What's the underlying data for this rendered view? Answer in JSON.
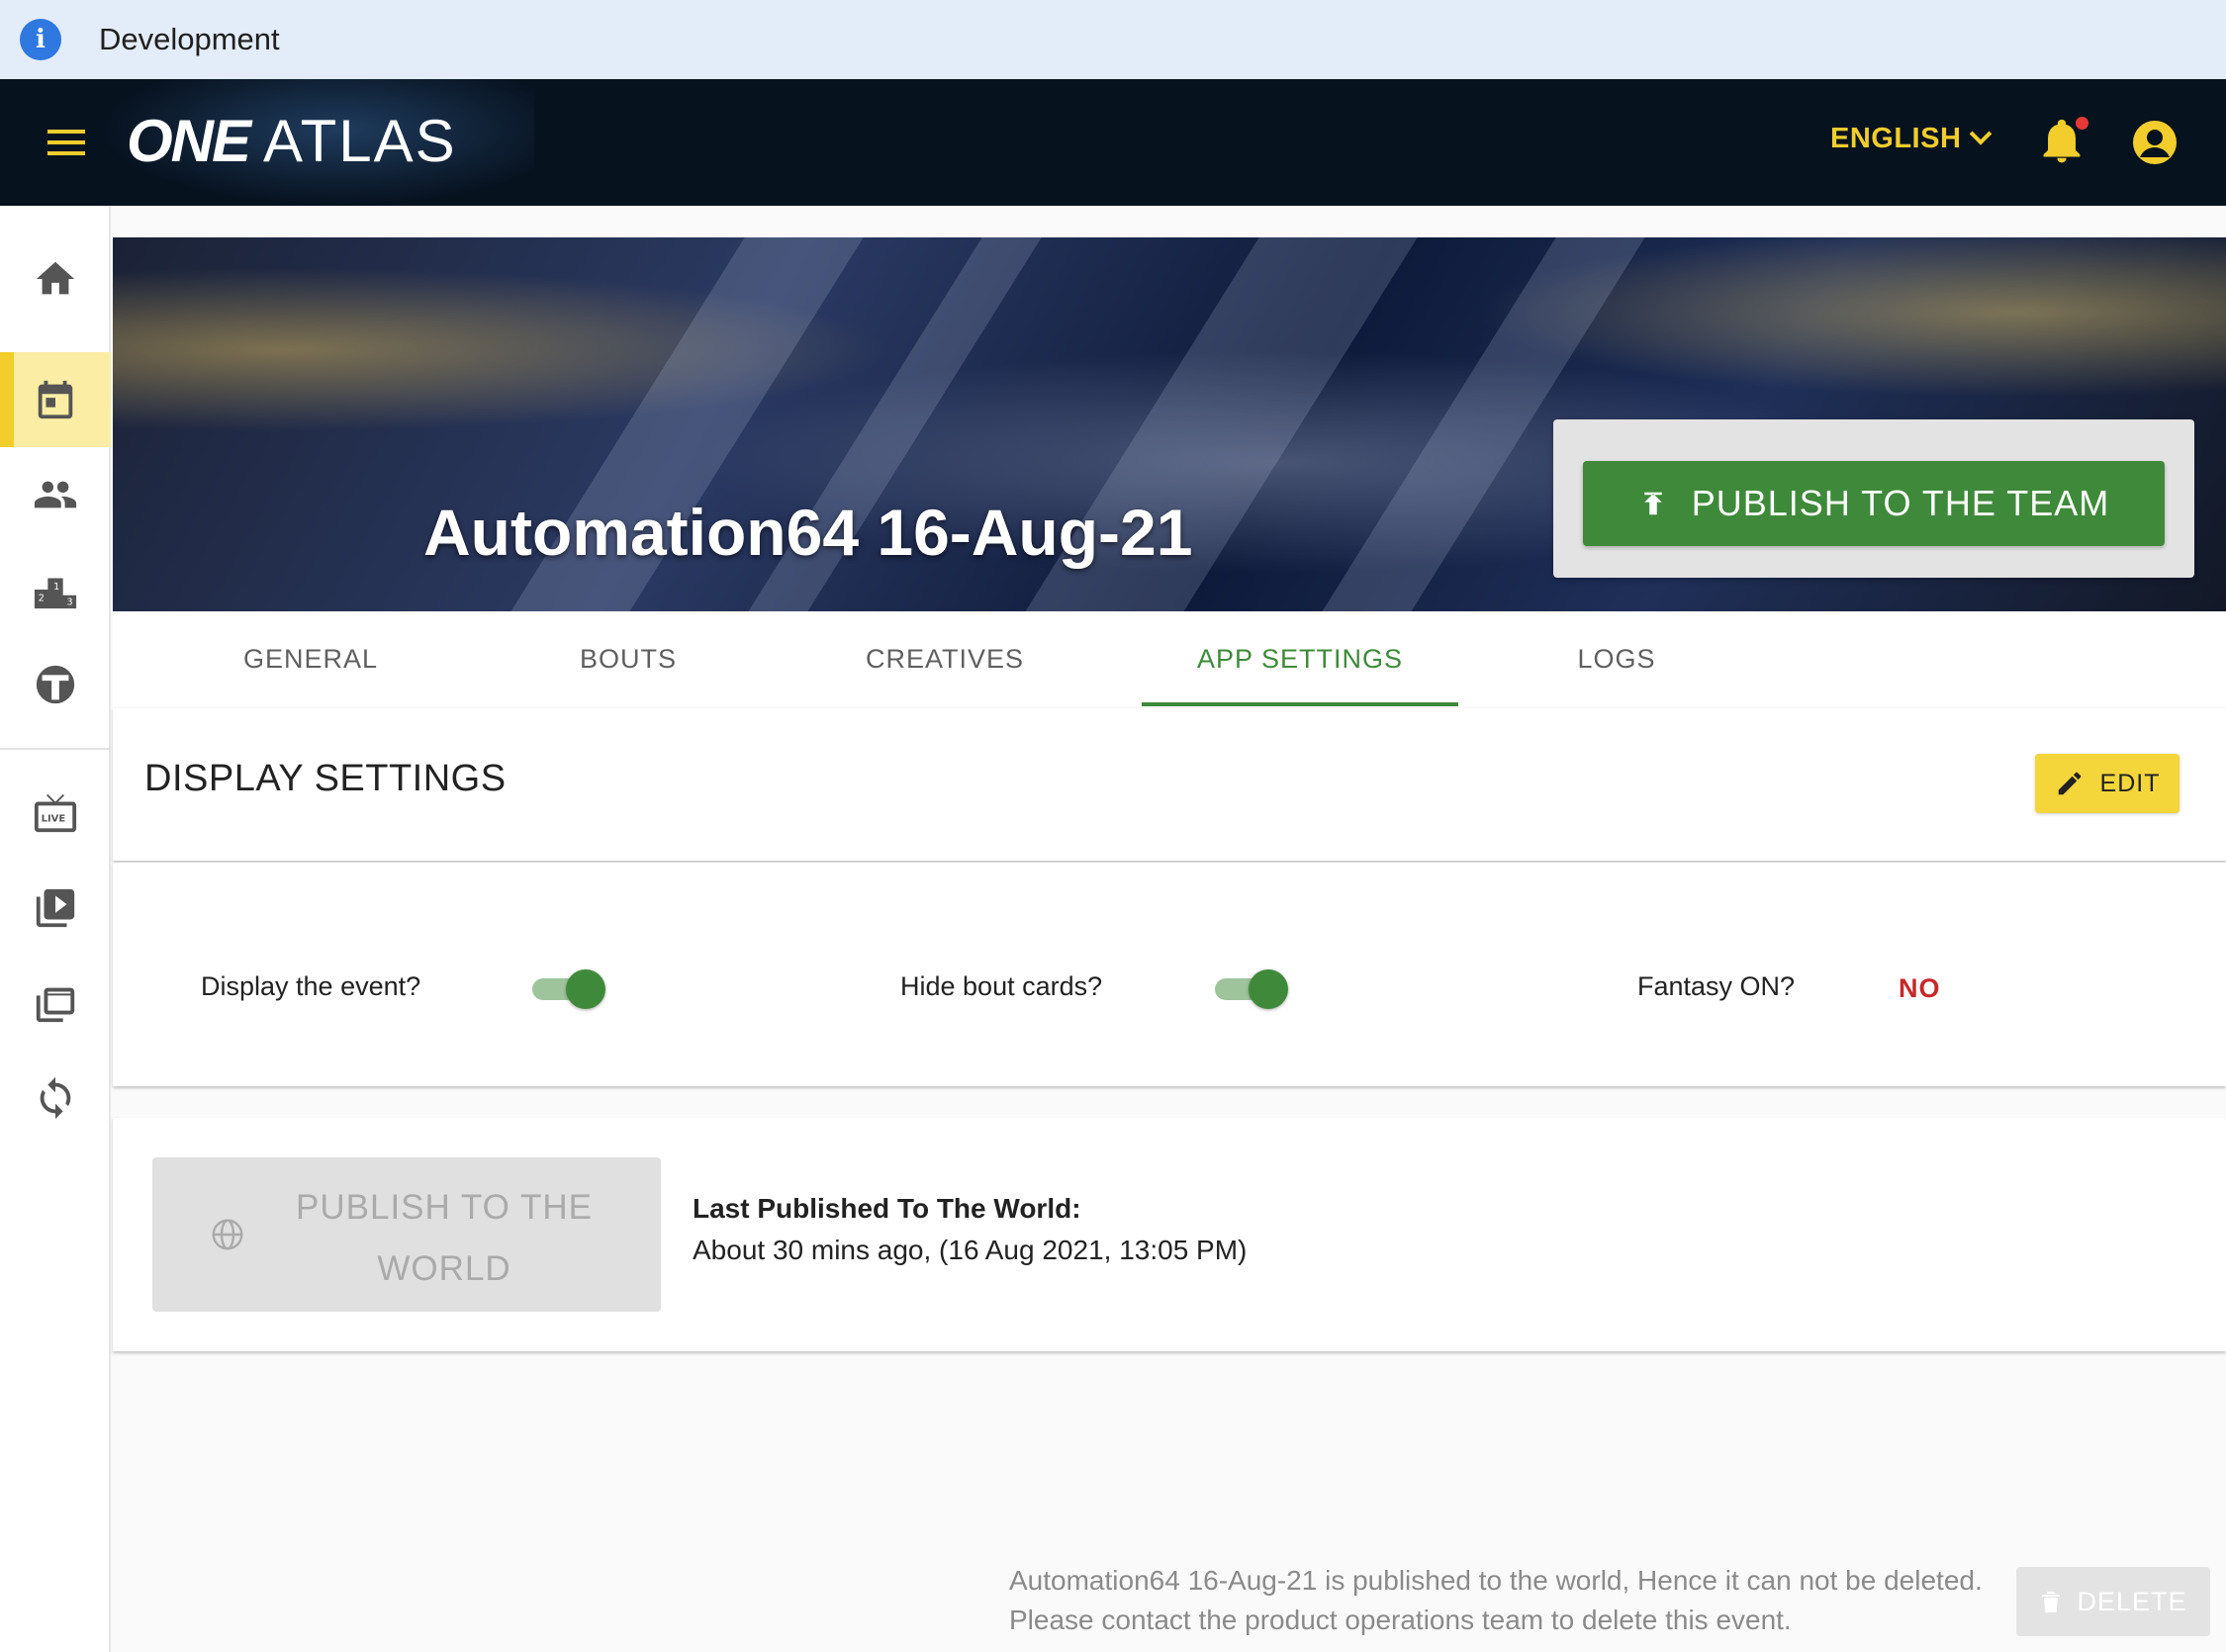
{
  "banner": {
    "text": "Development",
    "icon": "info-icon"
  },
  "header": {
    "logo_one": "ONE",
    "logo_atlas": "ATLAS",
    "language": "ENGLISH",
    "accent_color": "#f2cd2c",
    "has_notification": true
  },
  "sidebar": {
    "items": [
      {
        "name": "home",
        "icon": "home-icon"
      },
      {
        "name": "events",
        "icon": "calendar-icon",
        "active": true
      },
      {
        "name": "athletes",
        "icon": "people-icon"
      },
      {
        "name": "rankings",
        "icon": "podium-icon"
      },
      {
        "name": "teams",
        "icon": "shield-icon"
      },
      {
        "name": "live",
        "icon": "live-tv-icon"
      },
      {
        "name": "videos",
        "icon": "video-library-icon"
      },
      {
        "name": "collections",
        "icon": "stack-icon"
      },
      {
        "name": "sync",
        "icon": "sync-icon"
      }
    ]
  },
  "event": {
    "title": "Automation64 16-Aug-21",
    "publish_team_label": "PUBLISH TO THE TEAM"
  },
  "tabs": [
    {
      "label": "GENERAL"
    },
    {
      "label": "BOUTS"
    },
    {
      "label": "CREATIVES"
    },
    {
      "label": "APP SETTINGS",
      "active": true
    },
    {
      "label": "LOGS"
    }
  ],
  "display_settings": {
    "title": "DISPLAY SETTINGS",
    "edit_label": "EDIT",
    "display_event_label": "Display the event?",
    "display_event_on": true,
    "hide_bout_cards_label": "Hide bout cards?",
    "hide_bout_cards_on": true,
    "fantasy_label": "Fantasy ON?",
    "fantasy_value": "NO"
  },
  "publish_world": {
    "button_label": "PUBLISH TO THE WORLD",
    "disabled": true,
    "last_published_label": "Last Published To The World:",
    "last_published_value": "About 30 mins ago, (16 Aug 2021, 13:05 PM)"
  },
  "footer": {
    "note_line1": "Automation64 16-Aug-21 is published to the world, Hence it can not be deleted.",
    "note_line2": "Please contact the product operations team to delete this event.",
    "delete_label": "DELETE",
    "delete_disabled": true
  },
  "colors": {
    "primary_green": "#3f8a3a",
    "warning_red": "#c62828",
    "header_bg": "#07121f"
  }
}
